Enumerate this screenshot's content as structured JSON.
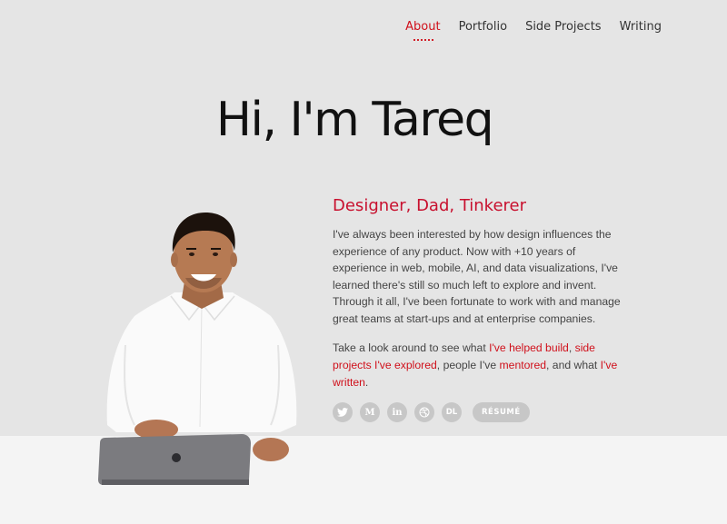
{
  "nav": {
    "items": [
      {
        "label": "About",
        "active": true
      },
      {
        "label": "Portfolio",
        "active": false
      },
      {
        "label": "Side Projects",
        "active": false
      },
      {
        "label": "Writing",
        "active": false
      }
    ]
  },
  "hero": {
    "title": "Hi, I'm Tareq"
  },
  "intro": {
    "subtitle": "Designer, Dad, Tinkerer",
    "bio": "I've always been interested by how design influences the experience of any product. Now with +10 years of experience in web, mobile, AI, and data visualizations, I've learned there's still so much left to explore and invent. Through it all, I've been fortunate to work with and manage great teams at start-ups and at enterprise companies.",
    "cta": {
      "t1": "Take a look around to see what ",
      "link_build": "I've helped build",
      "t2": ", ",
      "link_side": "side projects I've explored",
      "t3": ", people I've ",
      "link_mentored": "mentored",
      "t4": ", and what ",
      "link_written": "I've written",
      "t5": "."
    }
  },
  "social": {
    "twitter": {
      "icon": "twitter-icon"
    },
    "medium": {
      "icon": "medium-icon",
      "glyph": "M"
    },
    "linkedin": {
      "icon": "linkedin-icon",
      "glyph": "in"
    },
    "dribbble": {
      "icon": "dribbble-icon"
    },
    "dl": {
      "icon": "dl-icon",
      "glyph": "DL"
    },
    "resume_label": "RÉSUMÉ"
  },
  "colors": {
    "accent": "#d0101b",
    "background": "#e5e5e5",
    "icon_bg": "#c7c7c7"
  }
}
